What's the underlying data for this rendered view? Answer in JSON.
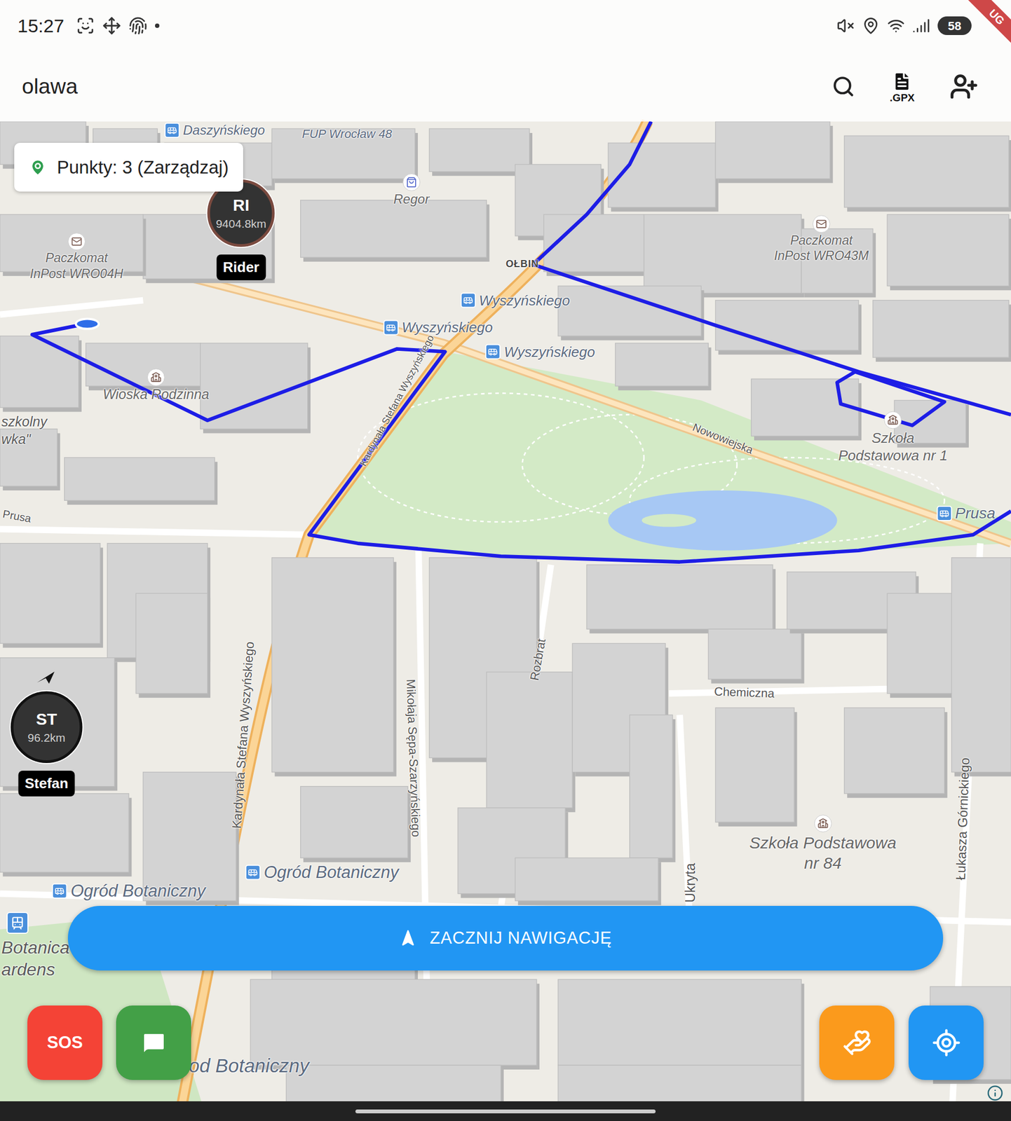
{
  "status_bar": {
    "time": "15:27",
    "battery": "58",
    "debug_banner": "UG"
  },
  "top_bar": {
    "title": "olawa",
    "gpx_label": ".GPX"
  },
  "points_chip": {
    "label": "Punkty: 3 (Zarządzaj)"
  },
  "riders": [
    {
      "initials": "RI",
      "distance": "9404.8km",
      "name": "Rider",
      "color": "#7a4a3f"
    },
    {
      "initials": "ST",
      "distance": "96.2km",
      "name": "Stefan",
      "color": "#111111"
    }
  ],
  "map_labels": [
    {
      "text": "Daszyńskiego",
      "kind": "bus"
    },
    {
      "text": "FUP Wrocław 48",
      "kind": "poi"
    },
    {
      "text": "Regor",
      "kind": "shop"
    },
    {
      "text": "Paczkomat\nInPost WRO04H",
      "kind": "parcel"
    },
    {
      "text": "Paczkomat\nInPost WRO43M",
      "kind": "parcel"
    },
    {
      "text": "OŁBIN",
      "kind": "district"
    },
    {
      "text": "Wyszyńskiego",
      "kind": "bus"
    },
    {
      "text": "Wyszyńskiego",
      "kind": "bus"
    },
    {
      "text": "Wyszyńskiego",
      "kind": "bus"
    },
    {
      "text": "Wioska Rodzinna",
      "kind": "school"
    },
    {
      "text": "szkolny\nwka\"",
      "kind": "edge"
    },
    {
      "text": "Kardynała Stefana Wyszyńskiego",
      "kind": "street"
    },
    {
      "text": "Nowowiejska",
      "kind": "street"
    },
    {
      "text": "Szkoła\nPodstawowa nr 1",
      "kind": "school"
    },
    {
      "text": "Prusa",
      "kind": "bus"
    },
    {
      "text": "Prusa",
      "kind": "street"
    },
    {
      "text": "Chemiczna",
      "kind": "street"
    },
    {
      "text": "Mikołaja Sępa-Szarzyńskiego",
      "kind": "street"
    },
    {
      "text": "Rozbrat",
      "kind": "street"
    },
    {
      "text": "Kardynała Stefana Wyszyńskiego",
      "kind": "street"
    },
    {
      "text": "Szkoła Podstawowa\nnr 84",
      "kind": "school"
    },
    {
      "text": "Łukasza Górnickiego",
      "kind": "street"
    },
    {
      "text": "Ukryta",
      "kind": "street"
    },
    {
      "text": "Ogród Botaniczny",
      "kind": "bus"
    },
    {
      "text": "Ogród Botaniczny",
      "kind": "bus"
    },
    {
      "text": "Botanica\nardens",
      "kind": "edge"
    },
    {
      "text": "od Botaniczny",
      "kind": "plain"
    }
  ],
  "navigate_button": {
    "label": "ZACZNIJ NAWIGACJĘ"
  },
  "sos_button": {
    "label": "SOS"
  }
}
